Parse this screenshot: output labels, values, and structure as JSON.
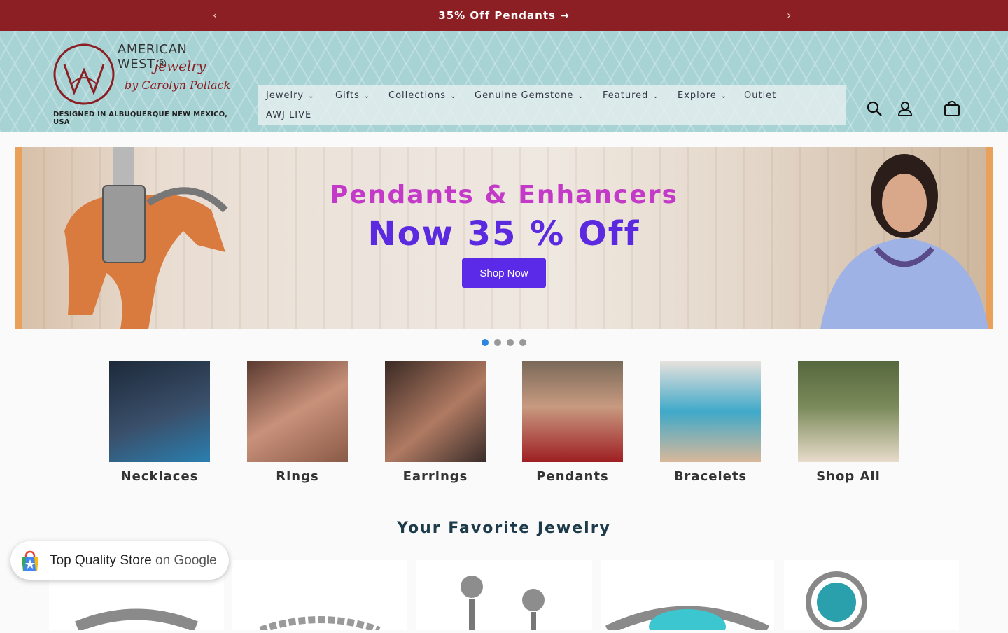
{
  "announcement": {
    "text": "35% Off Pendants →",
    "prev_icon": "chevron-left-icon",
    "next_icon": "chevron-right-icon"
  },
  "logo": {
    "brand": "AMERICAN WEST®",
    "script": "jewelry",
    "script2": "by Carolyn Pollack",
    "tagline": "DESIGNED IN ALBUQUERQUE NEW MEXICO, USA"
  },
  "nav": {
    "items": [
      "Jewelry",
      "Gifts",
      "Collections",
      "Genuine Gemstone",
      "Featured",
      "Explore",
      "Outlet",
      "AWJ LIVE"
    ]
  },
  "header_icons": [
    "search-icon",
    "account-icon",
    "cart-icon"
  ],
  "hero": {
    "line1": "Pendants & Enhancers",
    "line2": "Now 35 % Off",
    "button": "Shop Now",
    "slides": 4,
    "active_slide": 1
  },
  "categories": [
    "Necklaces",
    "Rings",
    "Earrings",
    "Pendants",
    "Bracelets",
    "Shop All"
  ],
  "section_title": "Your Favorite Jewelry",
  "badge": {
    "text": "Top Quality Store",
    "suffix": " on Google"
  },
  "colors": {
    "announcement_bg": "#8b1f24",
    "header_bg": "#a7d3d5",
    "hero_line1": "#c43ac8",
    "hero_line2": "#5b2ae0",
    "button_bg": "#5a2ae8",
    "dot_active": "#2b86e0"
  }
}
